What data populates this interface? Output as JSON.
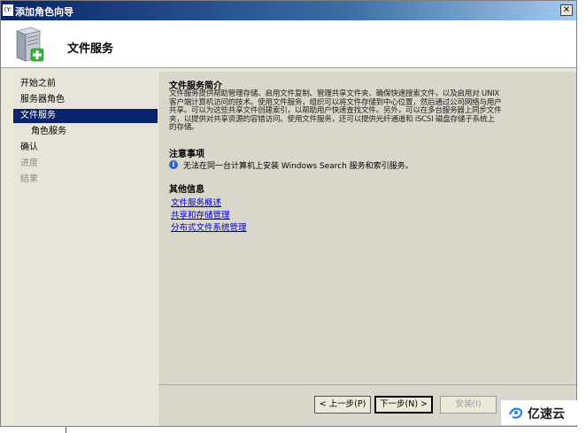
{
  "window": {
    "title": "添加角色向导",
    "app_icon_text": "(Y:"
  },
  "header": {
    "title": "文件服务"
  },
  "nav": {
    "items": [
      {
        "label": "开始之前",
        "state": "normal"
      },
      {
        "label": "服务器角色",
        "state": "normal"
      },
      {
        "label": "文件服务",
        "state": "active"
      },
      {
        "label": "角色服务",
        "state": "sub"
      },
      {
        "label": "确认",
        "state": "normal"
      },
      {
        "label": "进度",
        "state": "disabled"
      },
      {
        "label": "结果",
        "state": "disabled"
      }
    ]
  },
  "content": {
    "intro_heading": "文件服务简介",
    "intro_text": [
      "文件服务提供帮助管理存储、启用文件复制、管理共享文件夹、确保快速搜索文件，以及启用对 UNIX",
      "客户端计算机访问的技术。使用文件服务，组织可以将文件存储到中心位置，然后通过公司网络与用户",
      "共享。可以为这些共享文件创建索引，以帮助用户快速查找文件。另外，可以在多台服务器上同步文件",
      "夹，以提供对共享资源的容错访问。使用文件服务，还可以提供光纤通道和 iSCSI 磁盘存储子系统上",
      "的存储。"
    ],
    "notes_heading": "注意事项",
    "note": "无法在同一台计算机上安装 Windows Search 服务和索引服务。",
    "more_heading": "其他信息",
    "links": [
      "文件服务概述",
      "共享和存储管理",
      "分布式文件系统管理"
    ]
  },
  "buttons": {
    "back": "< 上一步(P)",
    "next": "下一步(N) >",
    "install": "安装(I)"
  },
  "watermark": {
    "text": "亿速云"
  },
  "colors": {
    "title_bar": "#0a246a",
    "active_nav": "#0a246a",
    "link": "#0000cc",
    "window_bg": "#ece9d8"
  },
  "icons": [
    "server-role-icon",
    "info-icon",
    "close-icon",
    "yisu-logo-icon"
  ]
}
